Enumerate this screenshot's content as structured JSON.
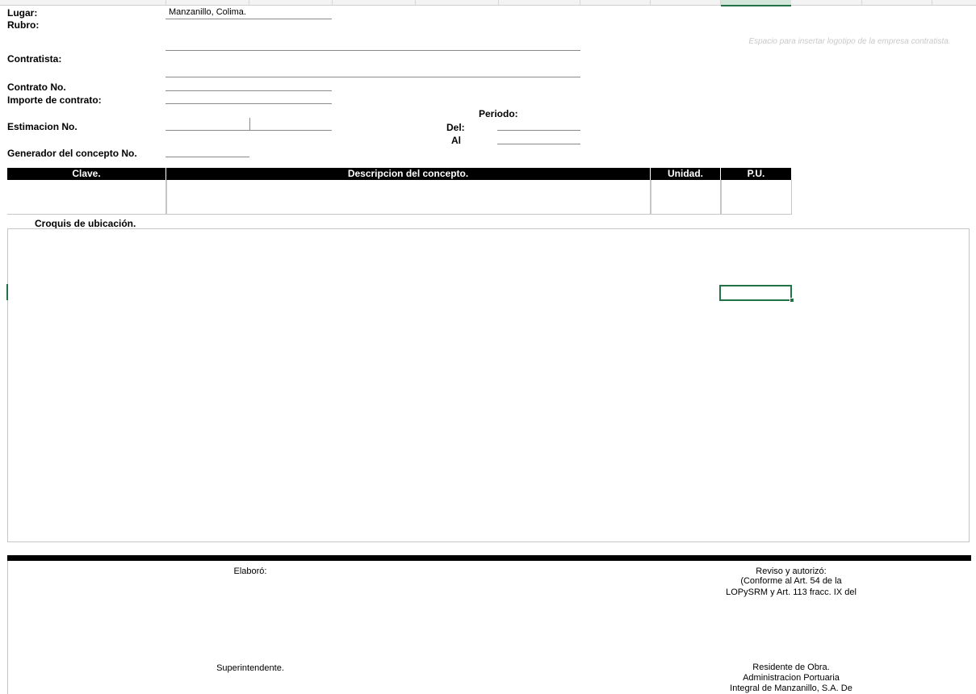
{
  "form": {
    "lugar_label": "Lugar:",
    "lugar_value": "Manzanillo, Colima.",
    "rubro_label": "Rubro:",
    "contratista_label": "Contratista:",
    "contrato_label": "Contrato No.",
    "importe_label": "Importe de contrato:",
    "periodo_label": "Periodo:",
    "estimacion_label": "Estimacion No.",
    "del_label": "Del:",
    "al_label": "Al",
    "generador_label": "Generador del concepto No.",
    "logo_placeholder": "Espacio para insertar logotipo de la empresa contratista."
  },
  "table": {
    "headers": [
      "Clave.",
      "Descripcion del concepto.",
      "Unidad.",
      "P.U."
    ]
  },
  "croquis": {
    "title": "Croquis de ubicación."
  },
  "signatures": {
    "elaboro_label": "Elaboró:",
    "elaboro_role": "Superintendente.",
    "reviso_label": "Reviso y autorizó:",
    "reviso_note_1": "(Conforme al Art. 54 de la",
    "reviso_note_2": "LOPySRM y Art. 113 fracc. IX del",
    "reviso_role": "Residente de Obra.",
    "reviso_org_1": "Administracion Portuaria",
    "reviso_org_2": "Integral de Manzanillo, S.A. De"
  },
  "colors": {
    "selection": "#217346",
    "header_bg": "#000000"
  }
}
